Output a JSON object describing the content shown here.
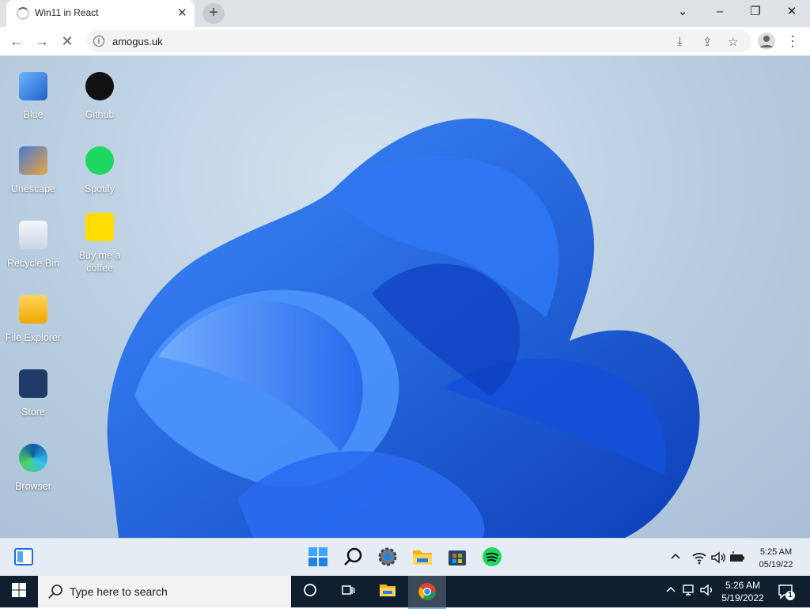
{
  "browser": {
    "tab_title": "Win11 in React",
    "url": "amogus.uk"
  },
  "desktop": {
    "icons": [
      {
        "label": "Blue"
      },
      {
        "label": "Github"
      },
      {
        "label": "Unescape"
      },
      {
        "label": "Spotify"
      },
      {
        "label": "Recycle Bin"
      },
      {
        "label": "Buy me a coffee"
      },
      {
        "label": "File Explorer"
      },
      {
        "label": "Store"
      },
      {
        "label": "Browser"
      }
    ]
  },
  "w11_taskbar": {
    "icons": [
      "widgets-icon",
      "start-icon",
      "search-icon",
      "settings-icon",
      "file-explorer-icon",
      "store-icon",
      "spotify-icon"
    ],
    "tray_icons": [
      "chevron-up-icon",
      "wifi-icon",
      "volume-icon",
      "battery-icon"
    ],
    "time": "5:25 AM",
    "date": "05/19/22"
  },
  "host_taskbar": {
    "search_placeholder": "Type here to search",
    "time": "5:26 AM",
    "date": "5/19/2022",
    "notification_count": "1"
  },
  "colors": {
    "wallpaper_bg": "#b8cde0",
    "bloom_blue": "#1a5fe0",
    "w10_taskbar": "#0f1f2f"
  }
}
